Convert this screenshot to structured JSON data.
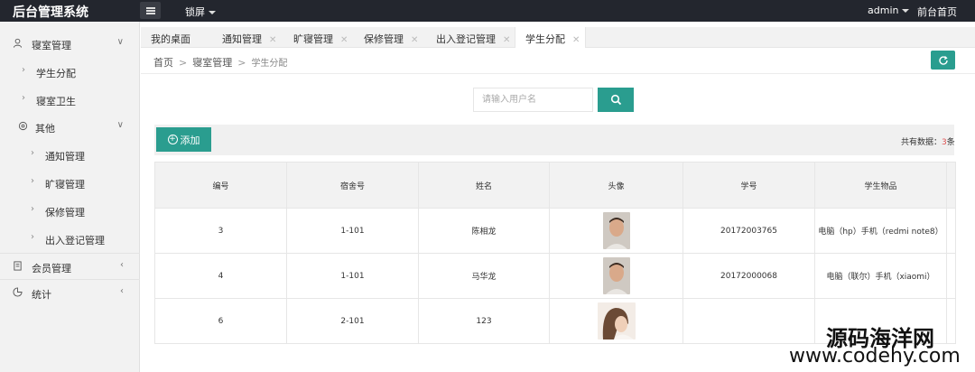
{
  "topbar": {
    "brand": "后台管理系统",
    "screen_menu": "锁屏",
    "user": "admin",
    "front_link": "前台首页"
  },
  "sidebar": {
    "dorm": {
      "label": "寝室管理",
      "icon": "user-icon"
    },
    "dorm_children": [
      "学生分配",
      "寝室卫生"
    ],
    "other": {
      "label": "其他",
      "icon": "gear-icon"
    },
    "other_children": [
      "通知管理",
      "旷寝管理",
      "保修管理",
      "出入登记管理"
    ],
    "member": {
      "label": "会员管理",
      "icon": "document-icon"
    },
    "stats": {
      "label": "统计",
      "icon": "chart-icon"
    }
  },
  "tabs": [
    {
      "label": "我的桌面"
    },
    {
      "label": "通知管理"
    },
    {
      "label": "旷寝管理"
    },
    {
      "label": "保修管理"
    },
    {
      "label": "出入登记管理"
    },
    {
      "label": "学生分配"
    }
  ],
  "breadcrumb": {
    "home": "首页",
    "section": "寝室管理",
    "current": "学生分配",
    "sep": ">"
  },
  "search": {
    "placeholder": "请输入用户名"
  },
  "toolbar": {
    "add_label": "添加",
    "count_prefix": "共有数据：",
    "count_value": "3",
    "count_suffix": "条"
  },
  "table": {
    "headers": [
      "编号",
      "宿舍号",
      "姓名",
      "头像",
      "学号",
      "学生物品"
    ],
    "rows": [
      {
        "id": "3",
        "room": "1-101",
        "name": "陈相龙",
        "student_no": "20172003765",
        "items": "电脑（hp）手机（redmi note8）"
      },
      {
        "id": "4",
        "room": "1-101",
        "name": "马华龙",
        "student_no": "20172000068",
        "items": "电脑（联尔）手机（xiaomi）"
      },
      {
        "id": "6",
        "room": "2-101",
        "name": "123",
        "student_no": "",
        "items": ""
      }
    ]
  },
  "watermark": {
    "line1": "源码海洋网",
    "line2": "www.codehy.com"
  },
  "colors": {
    "accent": "#2a9d8f",
    "topbar": "#23262e",
    "sidebar": "#f2f2f2"
  }
}
